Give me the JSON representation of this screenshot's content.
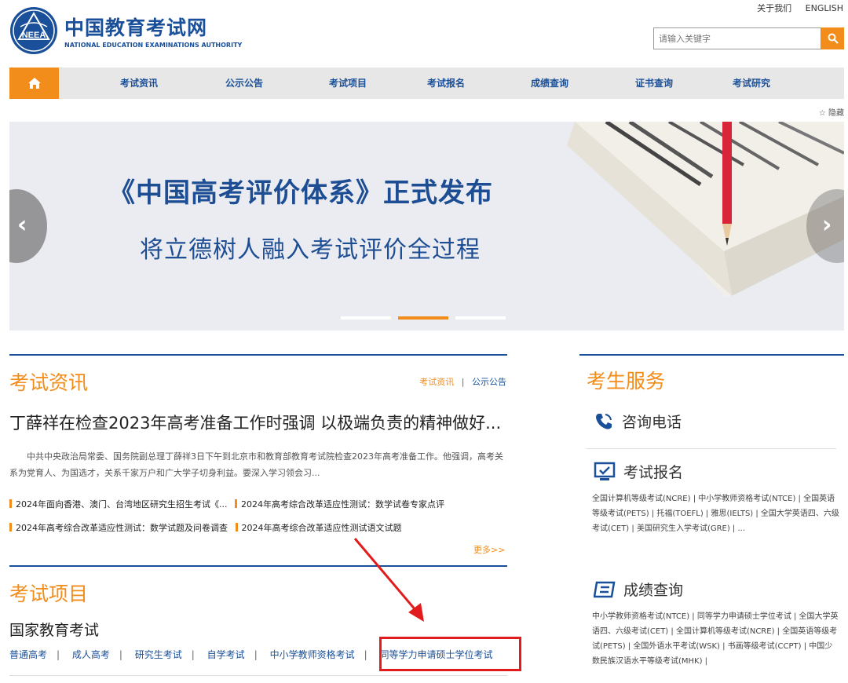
{
  "header": {
    "top_links": [
      "关于我们",
      "ENGLISH"
    ],
    "logo_cn": "中国教育考试网",
    "logo_en": "NATIONAL EDUCATION EXAMINATIONS AUTHORITY",
    "logo_emblem_text": "NEEA",
    "search_placeholder": "请输入关键字"
  },
  "nav": {
    "items": [
      "考试资讯",
      "公示公告",
      "考试项目",
      "考试报名",
      "成绩查询",
      "证书查询",
      "考试研究"
    ],
    "hide_label": "☆ 隐藏"
  },
  "banner": {
    "title": "《中国高考评价体系》正式发布",
    "subtitle": "将立德树人融入考试评价全过程",
    "active_slide": 2,
    "slide_count": 3
  },
  "news": {
    "heading": "考试资讯",
    "tab_active": "考试资讯",
    "tab_sep": "|",
    "tab_other": "公示公告",
    "headline": "丁薛祥在检查2023年高考准备工作时强调 以极端负责的精神做好...",
    "summary": "中共中央政治局常委、国务院副总理丁薛祥3日下午到北京市和教育部教育考试院检查2023年高考准备工作。他强调，高考关系为党育人、为国选才，关系千家万户和广大学子切身利益。要深入学习领会习...",
    "list": [
      "2024年面向香港、澳门、台湾地区研究生招生考试《...",
      "2024年高考综合改革适应性测试：数学试卷专家点评",
      "2024年高考综合改革适应性测试：数学试题及问卷调查",
      "2024年高考综合改革适应性测试语文试题"
    ],
    "more": "更多>>"
  },
  "projects": {
    "heading": "考试项目",
    "subheading": "国家教育考试",
    "links": [
      "普通高考",
      "成人高考",
      "研究生考试",
      "自学考试",
      "中小学教师资格考试",
      "同等学力申请硕士学位考试"
    ]
  },
  "services": {
    "heading": "考生服务",
    "phone": "咨询电话",
    "registration": {
      "title": "考试报名",
      "text": "全国计算机等级考试(NCRE) | 中小学教师资格考试(NTCE) | 全国英语等级考试(PETS) | 托福(TOEFL) | 雅思(IELTS) | 全国大学英语四、六级考试(CET) | 美国研究生入学考试(GRE) | ..."
    },
    "scores": {
      "title": "成绩查询",
      "text": "中小学教师资格考试(NTCE) | 同等学力申请硕士学位考试 | 全国大学英语四、六级考试(CET) | 全国计算机等级考试(NCRE) | 全国英语等级考试(PETS) | 全国外语水平考试(WSK) | 书画等级考试(CCPT) | 中国少数民族汉语水平等级考试(MHK) |"
    }
  },
  "colors": {
    "brand_blue": "#1a4f99",
    "accent_orange": "#f28c1a",
    "highlight_red": "#e21c1c"
  }
}
